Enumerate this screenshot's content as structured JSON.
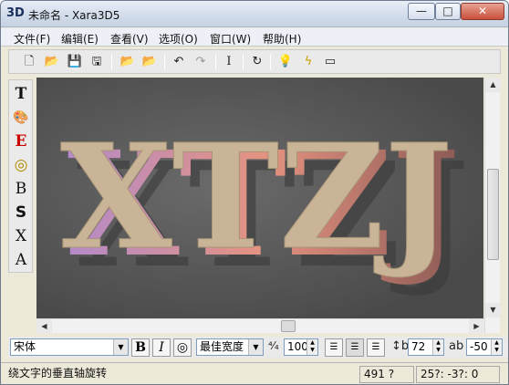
{
  "window": {
    "title": "未命名 - Xara3D5",
    "app_icon": "3D"
  },
  "title_buttons": {
    "minimize": "—",
    "maximize": "□",
    "close": "✕"
  },
  "menu": [
    "文件(F)",
    "编辑(E)",
    "查看(V)",
    "选项(O)",
    "窗口(W)",
    "帮助(H)"
  ],
  "toolbar": [
    {
      "name": "new-icon",
      "glyph": "🗋"
    },
    {
      "name": "open-icon",
      "glyph": "📂"
    },
    {
      "name": "save-icon",
      "glyph": "💾"
    },
    {
      "name": "export-icon",
      "glyph": "🖫"
    },
    {
      "name": "open-animation-icon",
      "glyph": "📂"
    },
    {
      "name": "open-style-icon",
      "glyph": "📂"
    },
    {
      "name": "undo-icon",
      "glyph": "↶"
    },
    {
      "name": "redo-icon",
      "glyph": "↷"
    },
    {
      "name": "text-cursor-icon",
      "glyph": "I"
    },
    {
      "name": "rotate-icon",
      "glyph": "↻"
    },
    {
      "name": "lightbulb-icon",
      "glyph": "💡"
    },
    {
      "name": "lightning-icon",
      "glyph": "ϟ"
    },
    {
      "name": "frame-icon",
      "glyph": "▭"
    }
  ],
  "left_tools": [
    {
      "name": "text-tool-icon",
      "glyph": "T"
    },
    {
      "name": "color-tool-icon",
      "glyph": "🎨"
    },
    {
      "name": "edit-text-tool-icon",
      "glyph": "E"
    },
    {
      "name": "bevel-tool-icon",
      "glyph": "◎"
    },
    {
      "name": "bold-tool-icon",
      "glyph": "B"
    },
    {
      "name": "shadow-tool-icon",
      "glyph": "S"
    },
    {
      "name": "extrude-tool-icon",
      "glyph": "X"
    },
    {
      "name": "texture-tool-icon",
      "glyph": "A"
    }
  ],
  "canvas": {
    "text": "XTZJ",
    "background": "#5a5a5a",
    "face_color": "#c9b497",
    "side_color": "#e08f7a"
  },
  "format": {
    "font": "宋体",
    "bold": "B",
    "italic": "I",
    "outline": "◎",
    "width_mode": "最佳宽度",
    "size": "100",
    "line_spacing": "72",
    "char_spacing": "-50"
  },
  "scroll": {
    "up": "▲",
    "down": "▼",
    "left": "◀",
    "right": "▶"
  },
  "status": {
    "hint": "绕文字的垂直轴旋转",
    "size": "491 ?267",
    "coords": "25?: -3?: 0"
  }
}
